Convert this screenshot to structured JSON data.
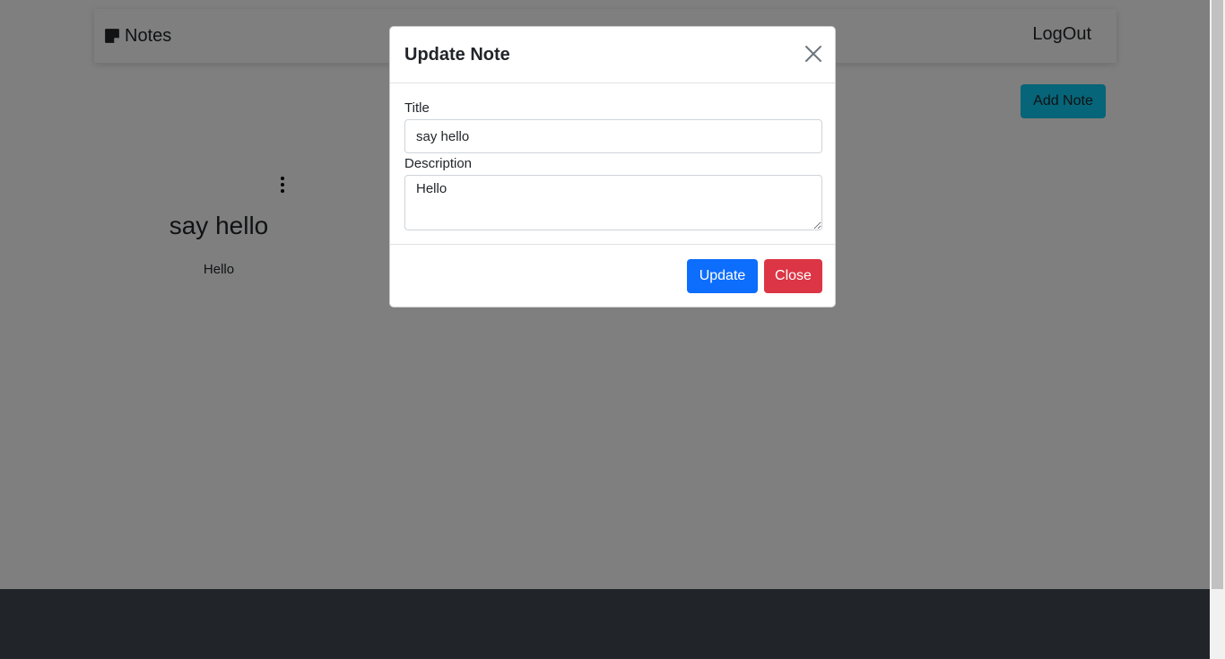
{
  "navbar": {
    "brand_label": "Notes",
    "brand_icon": "sticky-note-icon",
    "logout_label": "LogOut"
  },
  "toolbar": {
    "add_note_label": "Add Note"
  },
  "notes": [
    {
      "title": "say hello",
      "description": "Hello"
    },
    {
      "title": "",
      "description": ""
    }
  ],
  "modal": {
    "title": "Update Note",
    "close_icon": "close-icon",
    "title_label": "Title",
    "title_value": "say hello",
    "description_label": "Description",
    "description_value": "Hello",
    "update_label": "Update",
    "close_label": "Close"
  },
  "colors": {
    "primary": "#0d6efd",
    "danger": "#dc3545",
    "info": "#0dcaf0",
    "footer": "#212529"
  }
}
